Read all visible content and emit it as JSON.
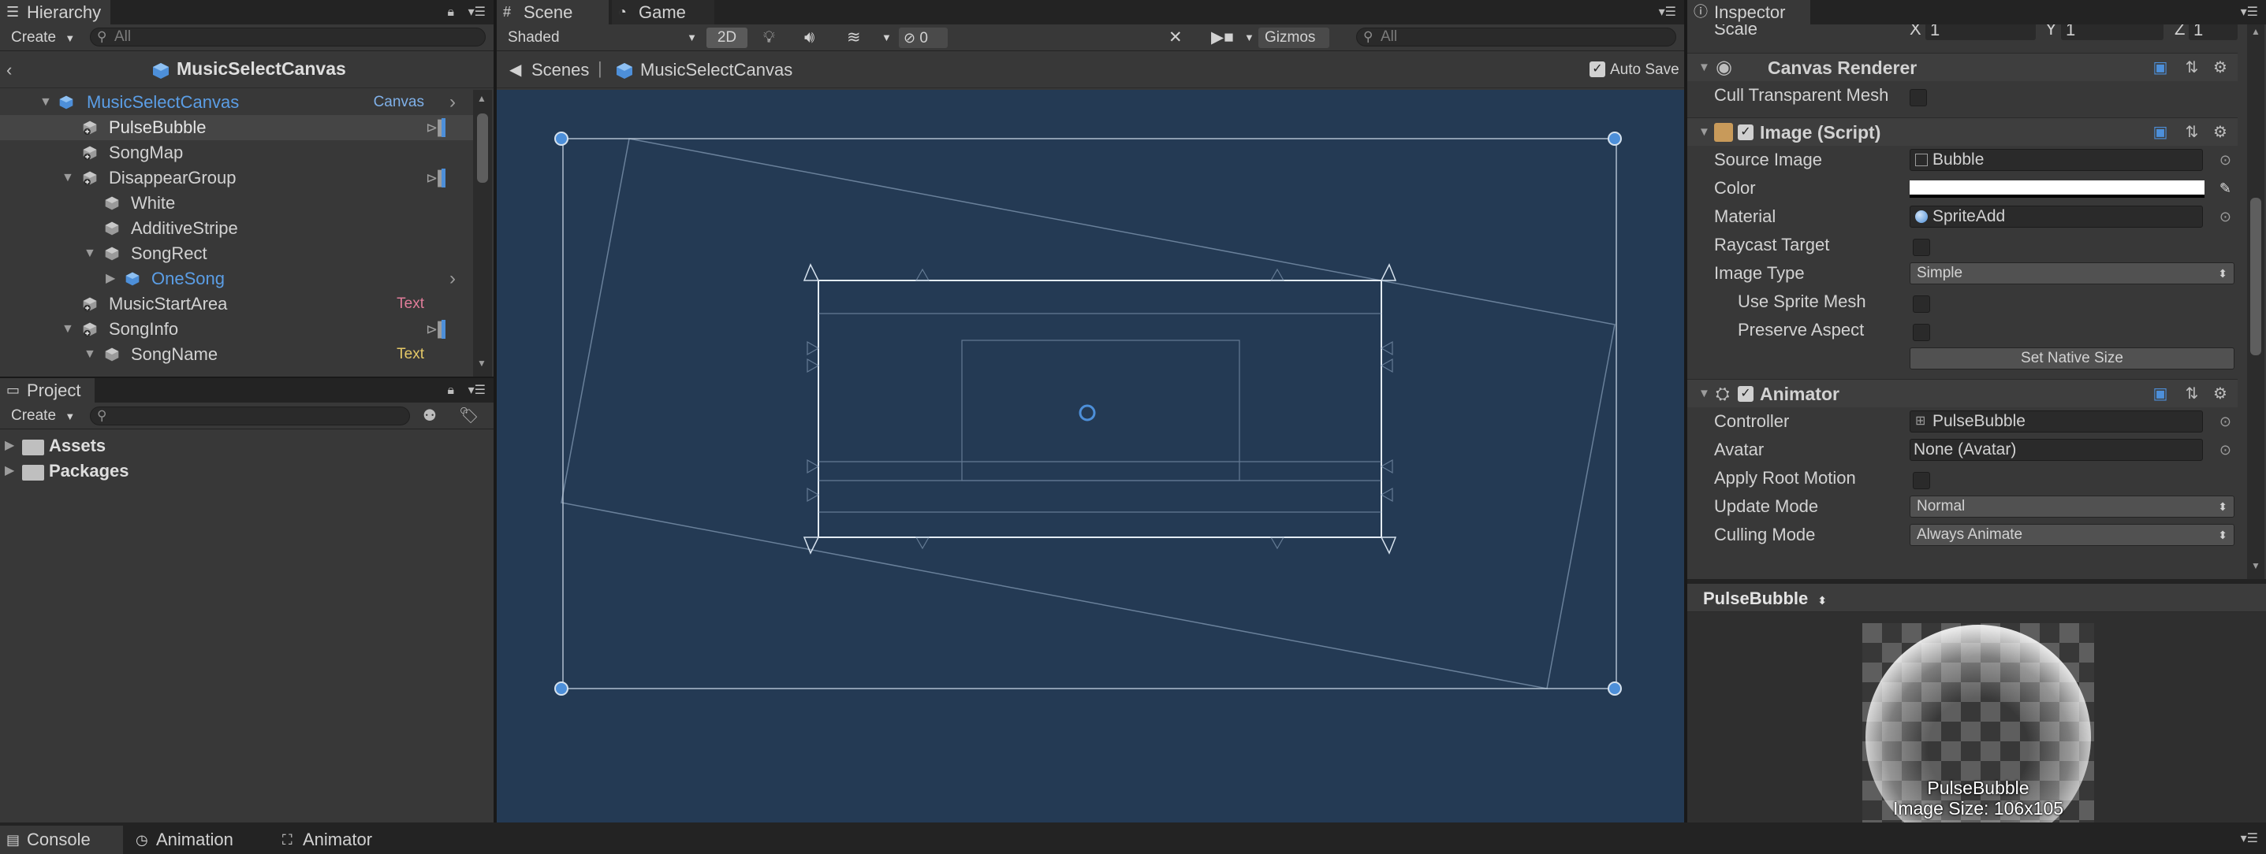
{
  "hierarchy": {
    "tab": "Hierarchy",
    "create": "Create",
    "search_placeholder": "All",
    "scene_title": "MusicSelectCanvas",
    "items": [
      {
        "label": "MusicSelectCanvas",
        "tag": "Canvas"
      },
      {
        "label": "PulseBubble",
        "tag": ""
      },
      {
        "label": "SongMap",
        "tag": ""
      },
      {
        "label": "DisappearGroup",
        "tag": ""
      },
      {
        "label": "White",
        "tag": ""
      },
      {
        "label": "AdditiveStripe",
        "tag": ""
      },
      {
        "label": "SongRect",
        "tag": ""
      },
      {
        "label": "OneSong",
        "tag": ""
      },
      {
        "label": "MusicStartArea",
        "tag": "Text"
      },
      {
        "label": "SongInfo",
        "tag": ""
      },
      {
        "label": "SongName",
        "tag": "Text"
      }
    ]
  },
  "project": {
    "tab": "Project",
    "create": "Create",
    "folders": [
      "Assets",
      "Packages"
    ]
  },
  "scene": {
    "tab_scene": "Scene",
    "tab_game": "Game",
    "shading": "Shaded",
    "mode_2d": "2D",
    "hidden_count": "0",
    "gizmos": "Gizmos",
    "search_placeholder": "All",
    "breadcrumb_scenes": "Scenes",
    "breadcrumb_canvas": "MusicSelectCanvas",
    "auto_save": "Auto Save"
  },
  "inspector": {
    "tab": "Inspector",
    "scale_label": "Scale",
    "scale_x_label": "X",
    "scale_x": "1",
    "scale_y_label": "Y",
    "scale_y": "1",
    "scale_z_label": "Z",
    "scale_z": "1",
    "canvas_renderer": {
      "title": "Canvas Renderer",
      "cull_label": "Cull Transparent Mesh"
    },
    "image": {
      "title": "Image (Script)",
      "source_image_label": "Source Image",
      "source_image": "Bubble",
      "color_label": "Color",
      "material_label": "Material",
      "material": "SpriteAdd",
      "raycast_label": "Raycast Target",
      "image_type_label": "Image Type",
      "image_type": "Simple",
      "use_sprite_mesh_label": "Use Sprite Mesh",
      "preserve_aspect_label": "Preserve Aspect",
      "set_native_size": "Set Native Size"
    },
    "animator": {
      "title": "Animator",
      "controller_label": "Controller",
      "controller": "PulseBubble",
      "avatar_label": "Avatar",
      "avatar": "None (Avatar)",
      "root_motion_label": "Apply Root Motion",
      "update_mode_label": "Update Mode",
      "update_mode": "Normal",
      "culling_mode_label": "Culling Mode",
      "culling_mode": "Always Animate"
    },
    "preview": {
      "selector": "PulseBubble",
      "name": "PulseBubble",
      "size": "Image Size: 106x105"
    }
  },
  "bottom_tabs": [
    "Console",
    "Animation",
    "Animator"
  ],
  "colors": {
    "scene_bg": "#243a54",
    "selected_blue": "#4d8fd9",
    "text_tag": "#e4c867",
    "pink_tag": "#e07d9a"
  }
}
